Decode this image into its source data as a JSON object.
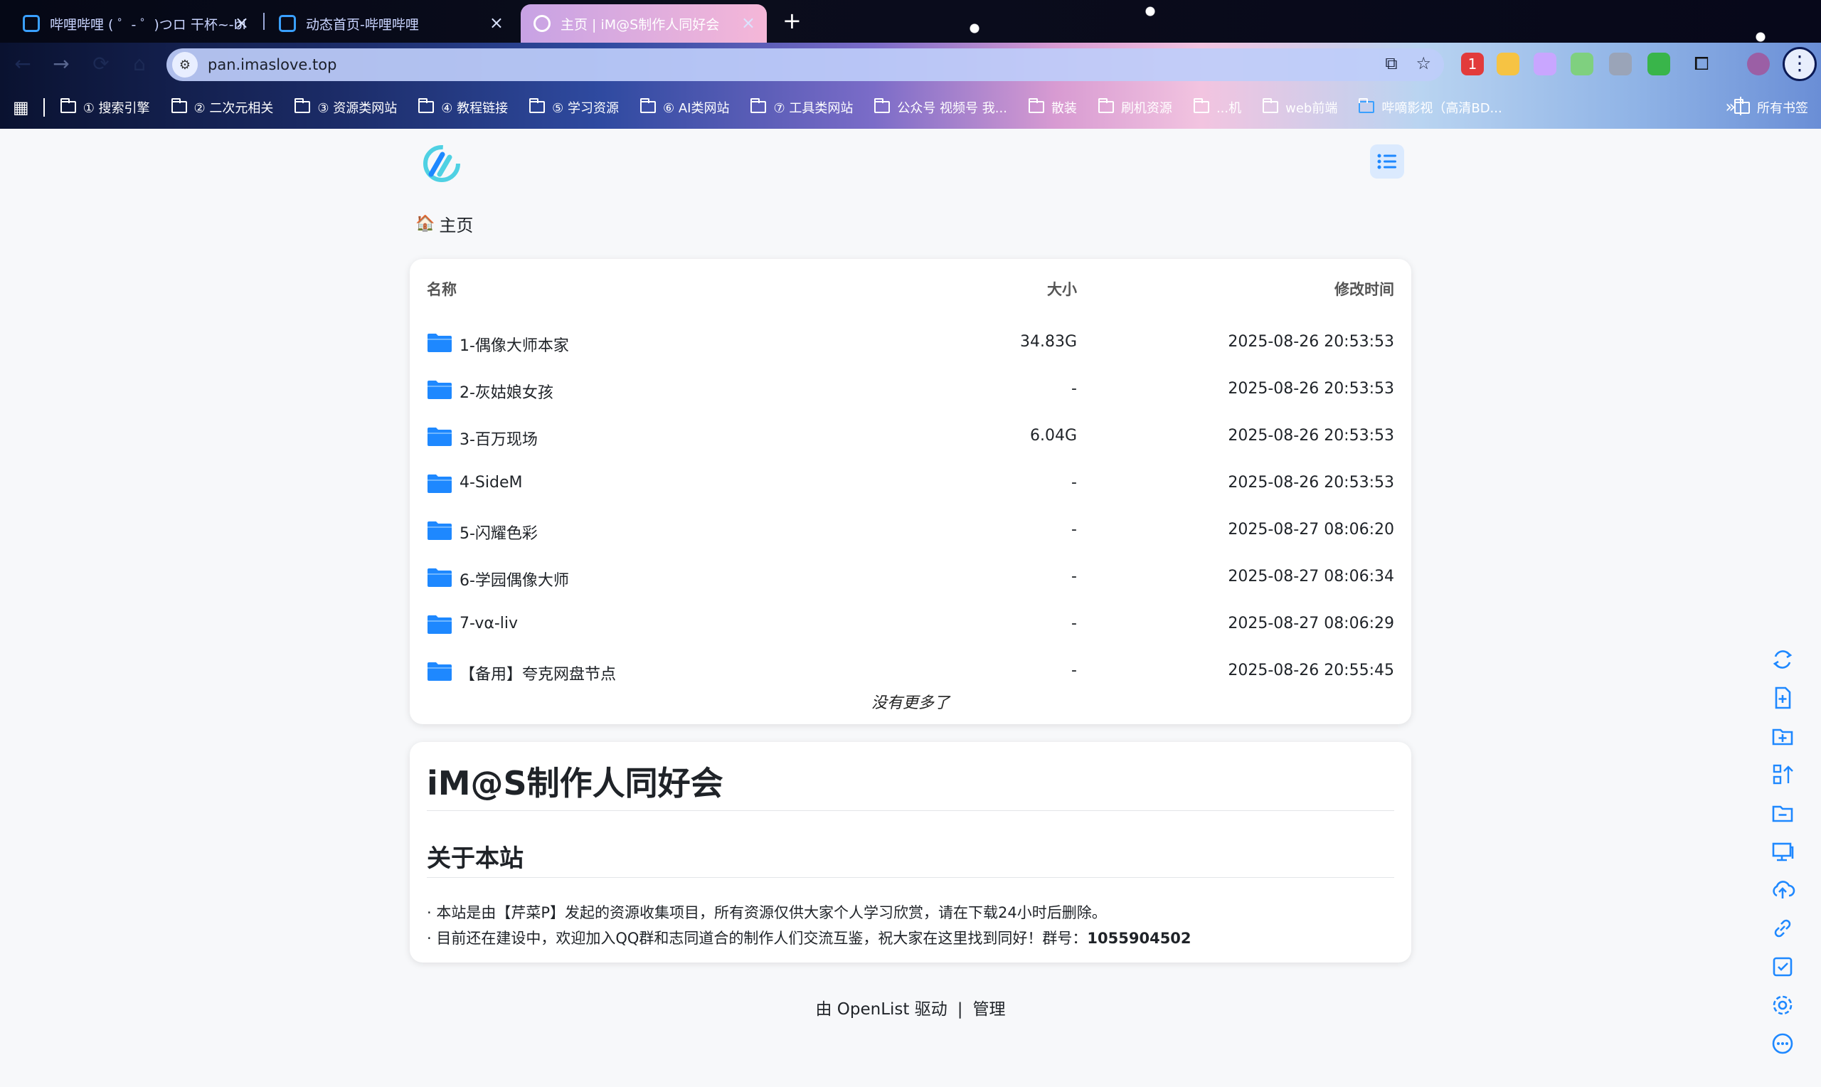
{
  "browser": {
    "tabs": [
      {
        "title": "哔哩哔哩 ( ゜- ゜)つロ 干杯~-bi",
        "active": false
      },
      {
        "title": "动态首页-哔哩哔哩",
        "active": false
      },
      {
        "title": "主页 | iM@S制作人同好会",
        "active": true
      }
    ],
    "url": "pan.imaslove.top",
    "bookmarks": [
      "① 搜索引擎",
      "② 二次元相关",
      "③ 资源类网站",
      "④ 教程链接",
      "⑤ 学习资源",
      "⑥ AI类网站",
      "⑦ 工具类网站",
      "公众号 视频号 我...",
      "散装",
      "刷机资源",
      "...机",
      "web前端",
      "哔嘀影视（高清BD..."
    ],
    "last_bookmark": "所有书签",
    "extension_badge": "1"
  },
  "page": {
    "breadcrumb": "主页",
    "columns": {
      "name": "名称",
      "size": "大小",
      "modified": "修改时间"
    },
    "files": [
      {
        "name": "1-偶像大师本家",
        "size": "34.83G",
        "modified": "2025-08-26 20:53:53"
      },
      {
        "name": "2-灰姑娘女孩",
        "size": "-",
        "modified": "2025-08-26 20:53:53"
      },
      {
        "name": "3-百万现场",
        "size": "6.04G",
        "modified": "2025-08-26 20:53:53"
      },
      {
        "name": "4-SideM",
        "size": "-",
        "modified": "2025-08-26 20:53:53"
      },
      {
        "name": "5-闪耀色彩",
        "size": "-",
        "modified": "2025-08-27 08:06:20"
      },
      {
        "name": "6-学园偶像大师",
        "size": "-",
        "modified": "2025-08-27 08:06:34"
      },
      {
        "name": "7-vα-liv",
        "size": "-",
        "modified": "2025-08-27 08:06:29"
      },
      {
        "name": "【备用】夸克网盘节点",
        "size": "-",
        "modified": "2025-08-26 20:55:45"
      }
    ],
    "no_more": "没有更多了",
    "readme": {
      "title": "iM@S制作人同好会",
      "section": "关于本站",
      "line1": "· 本站是由【芹菜P】发起的资源收集项目，所有资源仅供大家个人学习欣赏，请在下载24小时后删除。",
      "line2_prefix": "· 目前还在建设中，欢迎加入QQ群和志同道合的制作人们交流互鉴，祝大家在这里找到同好！群号：",
      "group_number": "1055904502"
    },
    "footer": {
      "powered": "由 OpenList 驱动",
      "separator": "|",
      "manage": "管理"
    },
    "accent_color": "#1e88ff",
    "right_tools": [
      "refresh-icon",
      "new-file-icon",
      "new-folder-icon",
      "batch-rename-icon",
      "delete-folder-icon",
      "offline-download-icon",
      "upload-icon",
      "link-icon",
      "select-icon",
      "settings-icon",
      "more-icon"
    ]
  }
}
